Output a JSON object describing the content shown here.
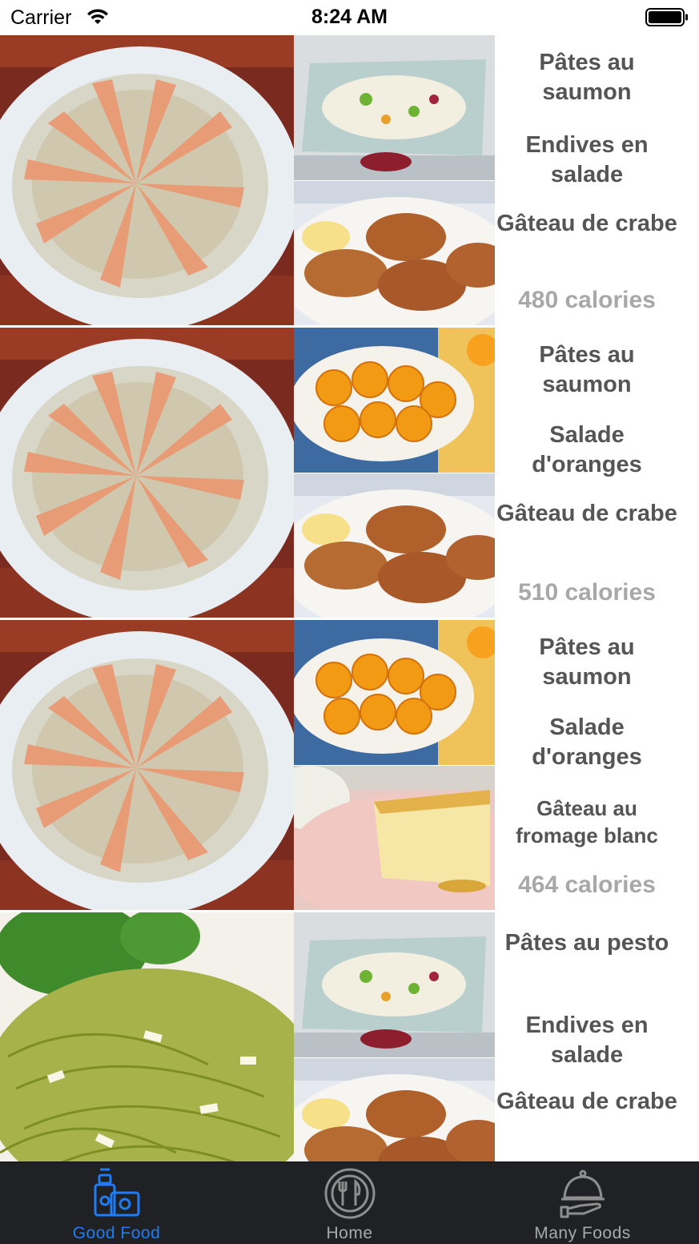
{
  "status_bar": {
    "carrier": "Carrier",
    "time": "8:24 AM"
  },
  "menus": [
    {
      "main_image": "salmon-pasta",
      "side_images": [
        "endive-salad",
        "crab-cakes"
      ],
      "dishes": [
        "Pâtes au saumon",
        "Endives en salade",
        "Gâteau de crabe"
      ],
      "calories": "480 calories"
    },
    {
      "main_image": "salmon-pasta",
      "side_images": [
        "orange-salad",
        "crab-cakes"
      ],
      "dishes": [
        "Pâtes au saumon",
        "Salade d'oranges",
        "Gâteau de crabe"
      ],
      "calories": "510 calories"
    },
    {
      "main_image": "salmon-pasta",
      "side_images": [
        "orange-salad",
        "cheesecake"
      ],
      "dishes": [
        "Pâtes au saumon",
        "Salade d'oranges",
        "Gâteau au fromage blanc"
      ],
      "calories": "464 calories"
    },
    {
      "main_image": "pesto-pasta",
      "side_images": [
        "endive-salad",
        "crab-cakes"
      ],
      "dishes": [
        "Pâtes au pesto",
        "Endives en salade",
        "Gâteau de crabe"
      ],
      "calories": ""
    }
  ],
  "tab_bar": {
    "tabs": [
      {
        "label": "Good Food",
        "icon": "grocery-icon",
        "active": true
      },
      {
        "label": "Home",
        "icon": "plate-cutlery-icon",
        "active": false
      },
      {
        "label": "Many Foods",
        "icon": "cloche-icon",
        "active": false
      }
    ],
    "active_color": "#1f7cf5",
    "inactive_color": "#a9a9a9"
  }
}
